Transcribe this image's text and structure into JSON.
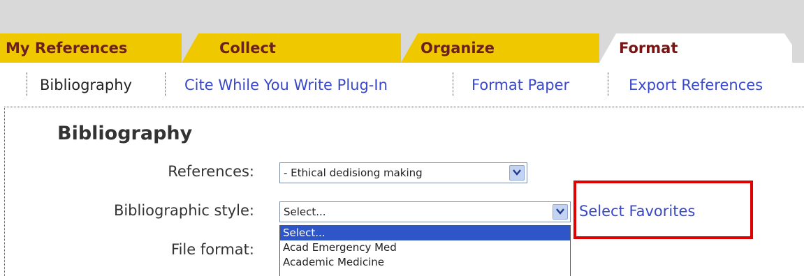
{
  "tabs": [
    {
      "label": "My References"
    },
    {
      "label": "Collect"
    },
    {
      "label": "Organize"
    },
    {
      "label": "Format"
    }
  ],
  "subnav": {
    "items": [
      {
        "label": "Bibliography"
      },
      {
        "label": "Cite While You Write Plug-In"
      },
      {
        "label": "Format Paper"
      },
      {
        "label": "Export References"
      }
    ]
  },
  "main": {
    "title": "Bibliography",
    "references_label": "References:",
    "references_value": "- Ethical dedisiong making",
    "style_label": "Bibliographic style:",
    "style_value": "Select...",
    "format_label": "File format:",
    "style_options": [
      "Select...",
      "Acad Emergency Med",
      "Academic Medicine"
    ],
    "select_favorites": "Select Favorites"
  },
  "colors": {
    "tab_yellow": "#efc800",
    "tab_text": "#6b1f1f",
    "link_blue": "#3848c8",
    "highlight_red": "#e00000",
    "selected_option": "#2e56c8"
  },
  "icons": {
    "dropdown": "chevron-down-icon"
  }
}
